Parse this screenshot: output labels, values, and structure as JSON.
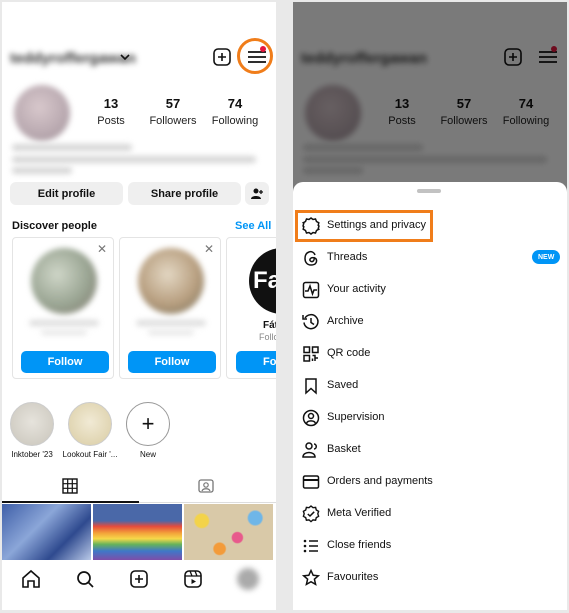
{
  "left": {
    "username": "teddyroffergawan",
    "stats": [
      {
        "num": "13",
        "label": "Posts"
      },
      {
        "num": "57",
        "label": "Followers"
      },
      {
        "num": "74",
        "label": "Following"
      }
    ],
    "edit_profile": "Edit profile",
    "share_profile": "Share profile",
    "discover_people": "Discover people",
    "see_all": "See All",
    "cards": [
      {
        "follow": "Follow"
      },
      {
        "follow": "Follow"
      },
      {
        "name": "Fát",
        "sub": "Follo",
        "follow": "Fo"
      }
    ],
    "highlights": [
      {
        "label": "Inktober '23"
      },
      {
        "label": "Lookout Fair '..."
      },
      {
        "label": "New"
      }
    ],
    "icons": {
      "menu": "hamburger-menu-icon",
      "plus": "new-post-icon",
      "grid": "grid-icon",
      "tagged": "tagged-icon"
    }
  },
  "menu": {
    "items": [
      {
        "label": "Settings and privacy",
        "icon": "gear-icon"
      },
      {
        "label": "Threads",
        "icon": "threads-icon",
        "badge": "NEW"
      },
      {
        "label": "Your activity",
        "icon": "activity-icon"
      },
      {
        "label": "Archive",
        "icon": "archive-icon"
      },
      {
        "label": "QR code",
        "icon": "qr-code-icon"
      },
      {
        "label": "Saved",
        "icon": "bookmark-icon"
      },
      {
        "label": "Supervision",
        "icon": "supervision-icon"
      },
      {
        "label": "Basket",
        "icon": "basket-icon"
      },
      {
        "label": "Orders and payments",
        "icon": "card-icon"
      },
      {
        "label": "Meta Verified",
        "icon": "verified-icon"
      },
      {
        "label": "Close friends",
        "icon": "close-friends-icon"
      },
      {
        "label": "Favourites",
        "icon": "star-icon"
      }
    ]
  },
  "colors": {
    "accent": "#0095f6",
    "highlight": "#f07d1a",
    "notification": "#e5173f"
  }
}
